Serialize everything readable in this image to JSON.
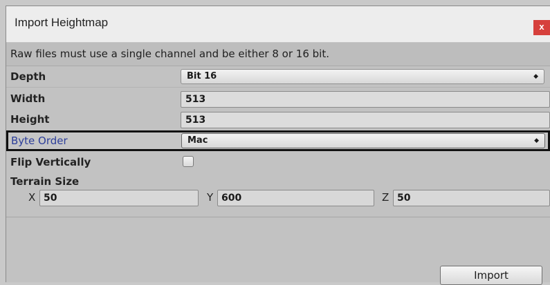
{
  "window": {
    "title": "Import Heightmap",
    "close_label": "x",
    "notice": "Raw files must use a single channel and be either 8 or 16 bit."
  },
  "fields": {
    "depth": {
      "label": "Depth",
      "value": "Bit 16"
    },
    "width": {
      "label": "Width",
      "value": "513"
    },
    "height": {
      "label": "Height",
      "value": "513"
    },
    "byte_order": {
      "label": "Byte Order",
      "value": "Mac"
    },
    "flip_vertically": {
      "label": "Flip Vertically",
      "checked": false
    },
    "terrain_size": {
      "label": "Terrain Size",
      "x_label": "X",
      "x_value": "50",
      "y_label": "Y",
      "y_value": "600",
      "z_label": "Z",
      "z_value": "50"
    }
  },
  "actions": {
    "import_label": "Import"
  },
  "icons": {
    "dropdown": "chevron-updown-icon",
    "close": "close-icon"
  },
  "colors": {
    "close_bg": "#d6403c",
    "active_label": "#2c3e9a"
  }
}
